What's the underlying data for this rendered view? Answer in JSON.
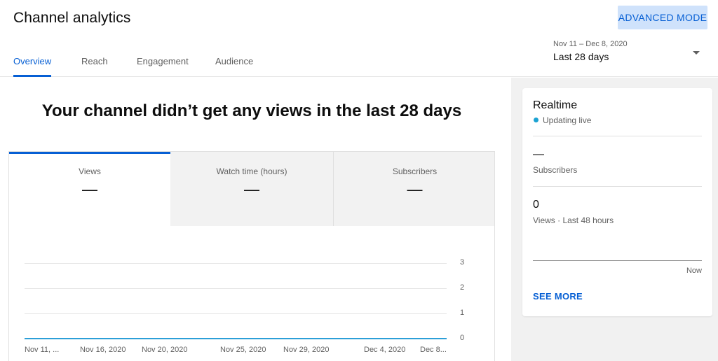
{
  "header": {
    "title": "Channel analytics",
    "advanced_mode_label": "ADVANCED MODE",
    "tabs": [
      {
        "label": "Overview",
        "active": true
      },
      {
        "label": "Reach",
        "active": false
      },
      {
        "label": "Engagement",
        "active": false
      },
      {
        "label": "Audience",
        "active": false
      }
    ],
    "date_range": {
      "range": "Nov 11 – Dec 8, 2020",
      "label": "Last 28 days"
    }
  },
  "main": {
    "headline": "Your channel didn’t get any views in the last 28 days",
    "metrics": [
      {
        "label": "Views",
        "value": "—",
        "selected": true
      },
      {
        "label": "Watch time (hours)",
        "value": "—",
        "selected": false
      },
      {
        "label": "Subscribers",
        "value": "—",
        "selected": false
      }
    ]
  },
  "chart_data": {
    "type": "line",
    "x": [
      "Nov 11, ...",
      "Nov 16, 2020",
      "Nov 20, 2020",
      "Nov 25, 2020",
      "Nov 29, 2020",
      "Dec 4, 2020",
      "Dec 8..."
    ],
    "series": [
      {
        "values": [
          0,
          0,
          0,
          0,
          0,
          0,
          0
        ]
      }
    ],
    "y_ticks": [
      "0",
      "1",
      "2",
      "3"
    ],
    "ylim": [
      0,
      3
    ],
    "grid": true,
    "line_color": "#2c9fd8"
  },
  "realtime": {
    "title": "Realtime",
    "status": "Updating live",
    "subscribers_value": "—",
    "subscribers_label": "Subscribers",
    "views_value": "0",
    "views_label": "Views · Last 48 hours",
    "now_label": "Now",
    "see_more_label": "SEE MORE"
  },
  "colors": {
    "accent": "#065fd4",
    "accent_bg": "#cfe2fb",
    "live_dot": "#1ba2d2"
  }
}
